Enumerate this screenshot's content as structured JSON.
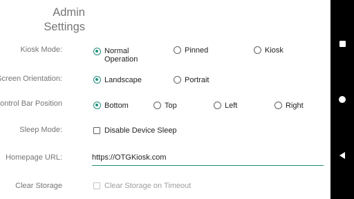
{
  "header": {
    "title_line1": "Admin",
    "title_line2": "Settings"
  },
  "kiosk_mode": {
    "label": "Kiosk Mode:",
    "options": [
      {
        "label_line1": "Normal",
        "label_line2": "Operation",
        "checked": true
      },
      {
        "label": "Pinned",
        "checked": false
      },
      {
        "label": "Kiosk",
        "checked": false
      }
    ]
  },
  "screen_orientation": {
    "label": "Screen Orientation:",
    "options": [
      {
        "label": "Landscape",
        "checked": true
      },
      {
        "label": "Portrait",
        "checked": false
      }
    ]
  },
  "control_bar_position": {
    "label": "Control Bar Position",
    "options": [
      {
        "label": "Bottom",
        "checked": true
      },
      {
        "label": "Top",
        "checked": false
      },
      {
        "label": "Left",
        "checked": false
      },
      {
        "label": "Right",
        "checked": false
      }
    ]
  },
  "sleep_mode": {
    "label": "Sleep Mode:",
    "checkbox_label": "Disable Device Sleep",
    "checked": false
  },
  "homepage_url": {
    "label": "Homepage URL:",
    "value": "https://OTGKiosk.com"
  },
  "clear_storage": {
    "label": "Clear Storage",
    "checkbox_label": "Clear Storage on Timeout",
    "checked": false,
    "disabled": true
  },
  "nav_bar": {
    "icons": [
      "recents-square-icon",
      "home-circle-icon",
      "back-triangle-icon"
    ]
  },
  "colors": {
    "accent": "#1f8f7c",
    "label": "#757575",
    "text": "#212121",
    "nav_background": "#000000"
  }
}
